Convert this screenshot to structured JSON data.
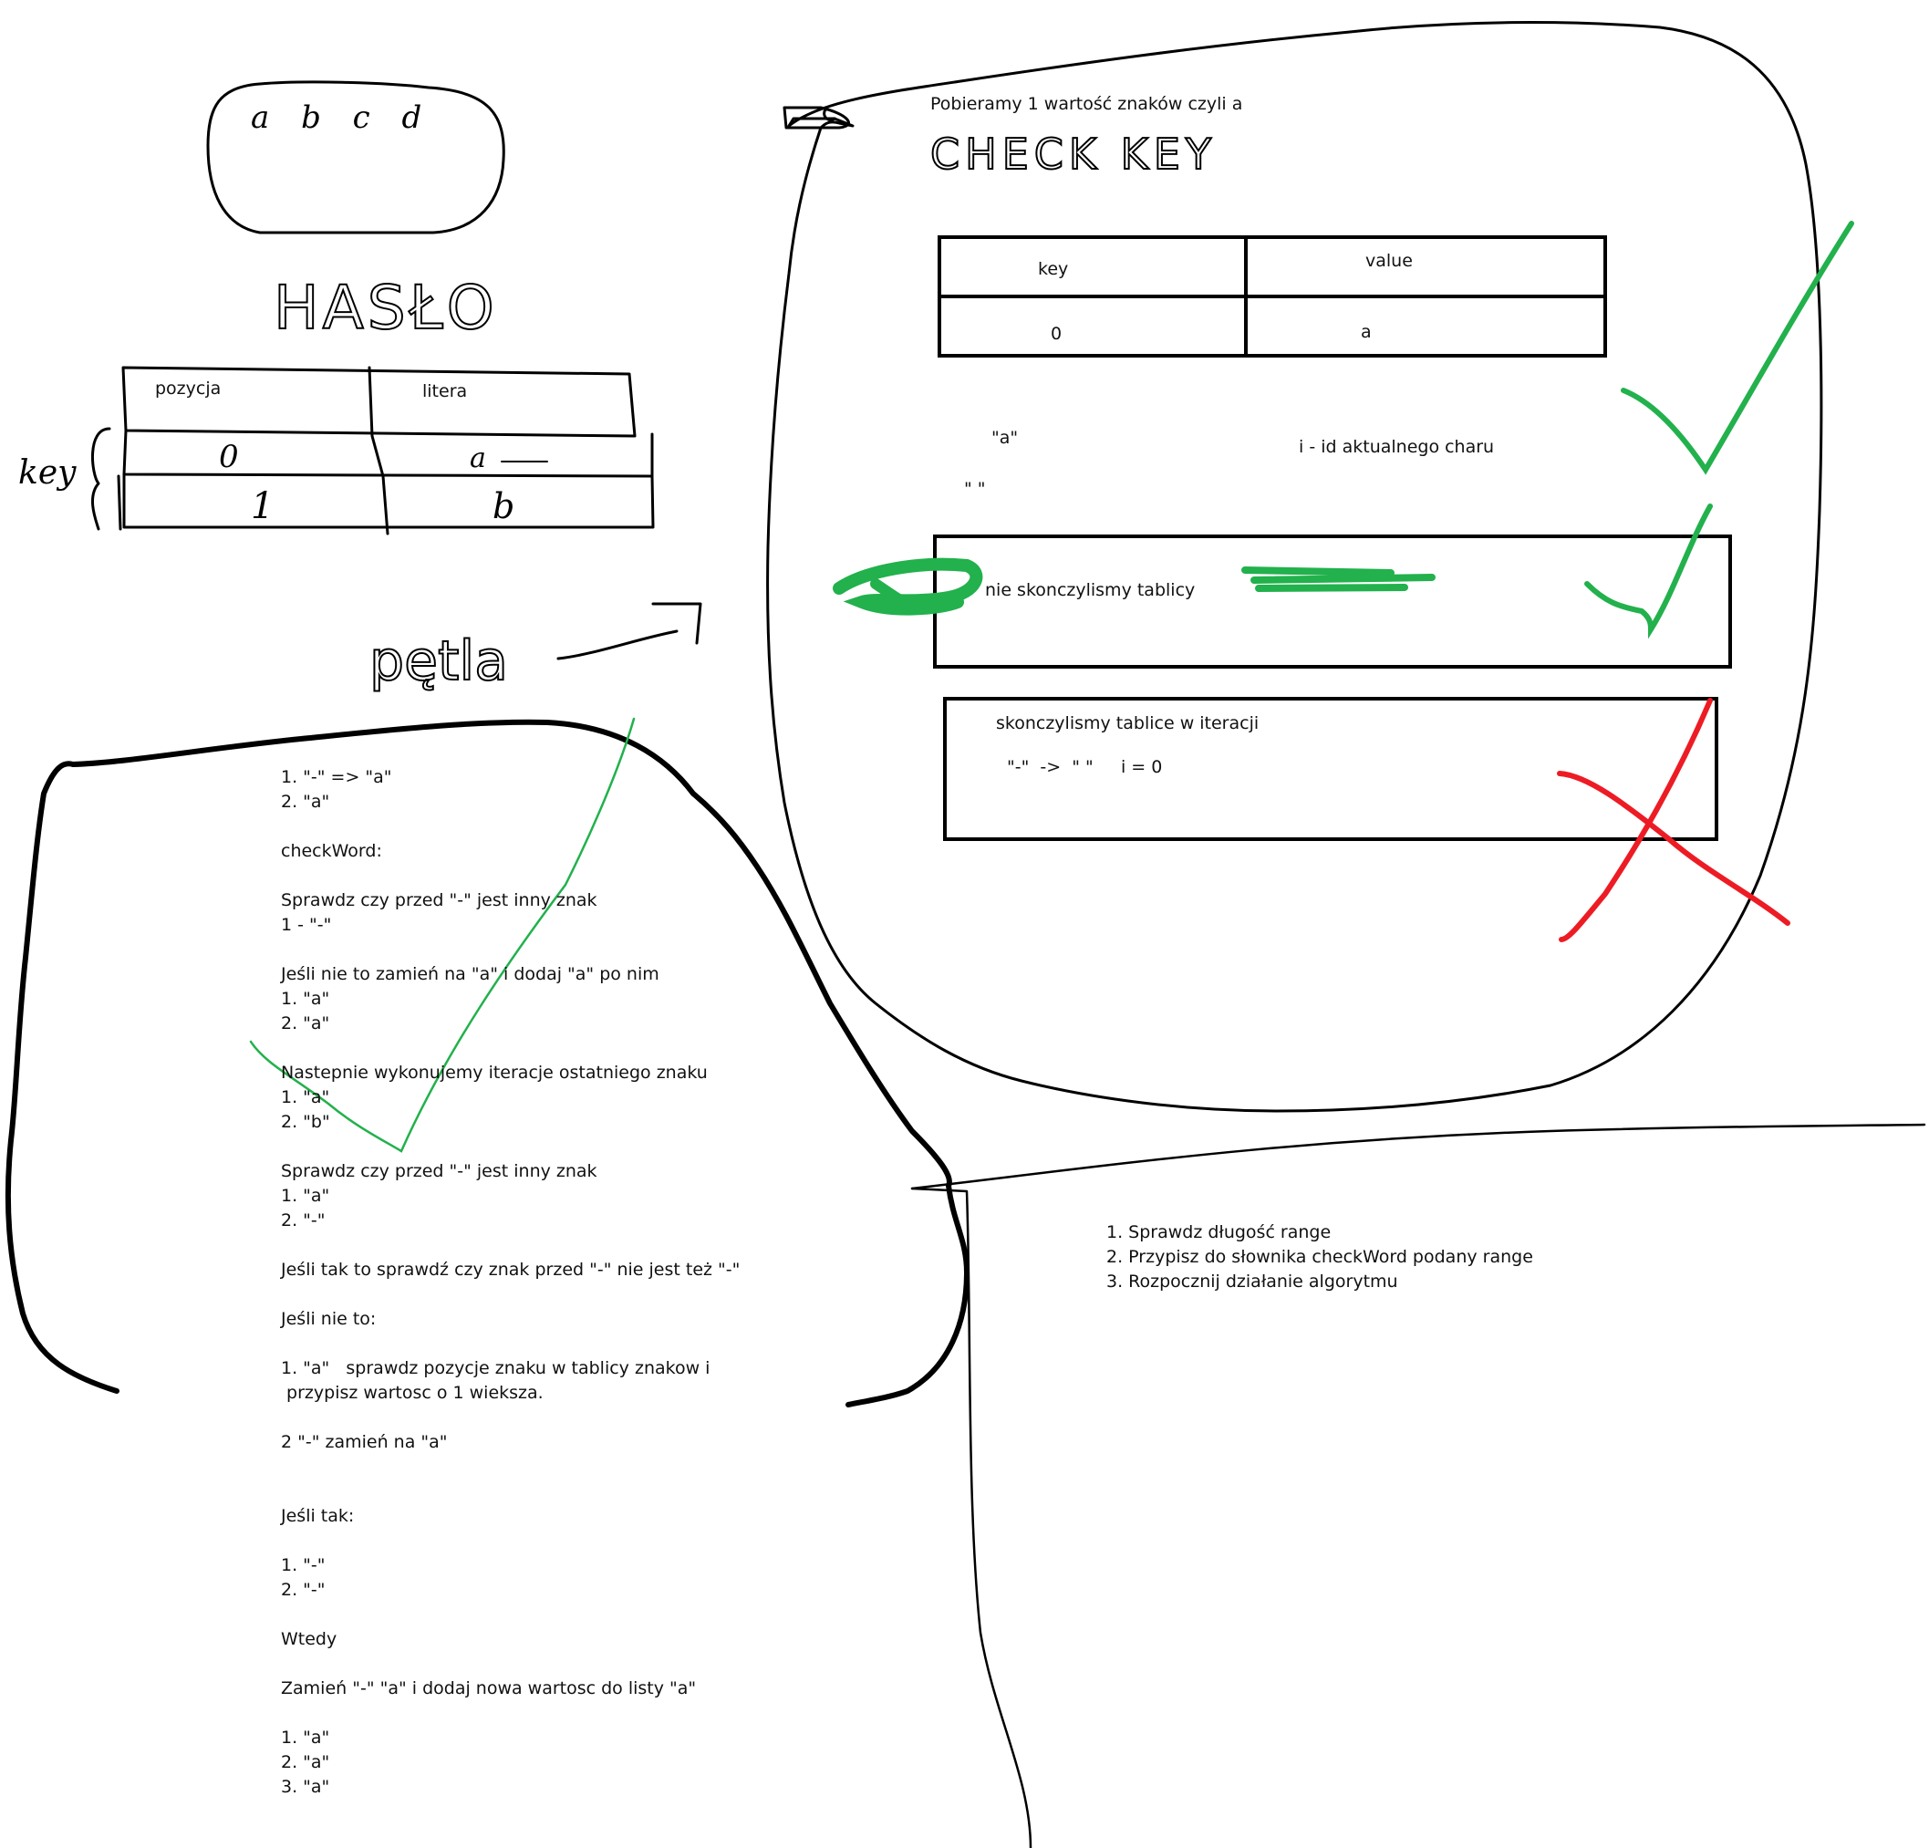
{
  "hand_drawn": {
    "letters_bubble": "a b c d",
    "haslo_heading": "HASŁO",
    "petla_heading": "pętla",
    "check_key_heading": "CHECK KEY",
    "key_side_label": "key"
  },
  "left_table": {
    "headers": [
      "pozycja",
      "litera"
    ],
    "rows": [
      [
        "0",
        "a"
      ],
      [
        "1",
        "b"
      ]
    ]
  },
  "top_right": {
    "intro": "Pobieramy 1 wartość znaków czyli a",
    "kv_table": {
      "headers": [
        "key",
        "value"
      ],
      "row": [
        "0",
        "a"
      ]
    },
    "quote_a": "\"a\"",
    "quote_empty": "\" \"",
    "i_note": "i - id aktualnego charu",
    "box1_text": "nie skonczylismy tablicy",
    "box2_line1": "skonczylismy tablice w iteracji",
    "box2_line2": "\"-\"  ->  \" \"     i = 0"
  },
  "algorithm_lines": [
    "1. \"-\" => \"a\"",
    "2. \"a\"",
    "",
    "checkWord:",
    "",
    "Sprawdz czy przed \"-\" jest inny znak",
    "1 - \"-\"",
    "",
    "Jeśli nie to zamień na \"a\" i dodaj \"a\" po nim",
    "1. \"a\"",
    "2. \"a\"",
    "",
    "Nastepnie wykonujemy iteracje ostatniego znaku",
    "1. \"a\"",
    "2. \"b\"",
    "",
    "Sprawdz czy przed \"-\" jest inny znak",
    "1. \"a\"",
    "2. \"-\"",
    "",
    "Jeśli tak to sprawdź czy znak przed \"-\" nie jest też \"-\"",
    "",
    "Jeśli nie to:",
    "",
    "1. \"a\"   sprawdz pozycje znaku w tablicy znakow i",
    " przypisz wartosc o 1 wieksza.",
    "",
    "2 \"-\" zamień na \"a\"",
    "",
    "",
    "Jeśli tak:",
    "",
    "1. \"-\"",
    "2. \"-\"",
    "",
    "Wtedy",
    "",
    "Zamień \"-\" \"a\" i dodaj nowa wartosc do listy \"a\"",
    "",
    "1. \"a\"",
    "2. \"a\"",
    "3. \"a\""
  ],
  "steps_lines": [
    "1. Sprawdz długość range",
    "2. Przypisz do słownika checkWord podany range",
    "3. Rozpocznij działanie algorytmu"
  ],
  "colors": {
    "ink": "#000000",
    "check_green": "#22b14c",
    "cross_red": "#ed1c24",
    "background": "#ffffff"
  }
}
